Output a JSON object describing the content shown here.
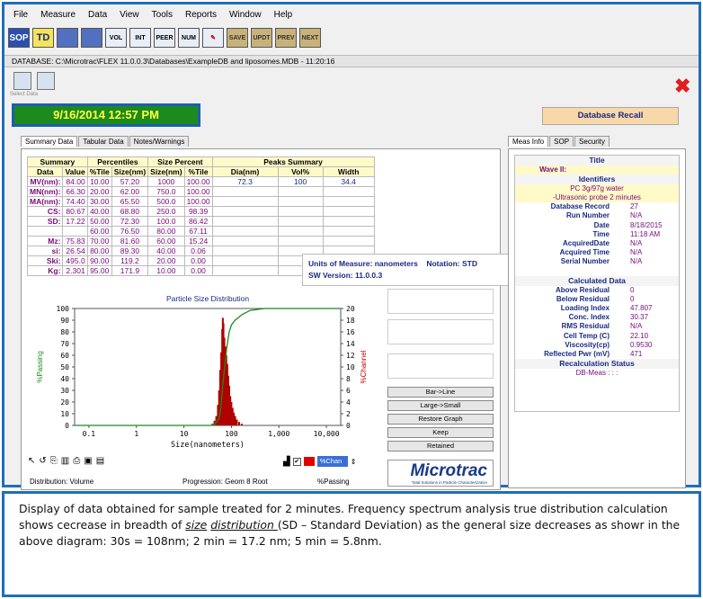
{
  "menu": [
    "File",
    "Measure",
    "Data",
    "View",
    "Tools",
    "Reports",
    "Window",
    "Help"
  ],
  "toolbar": [
    "SOP",
    "TD",
    "",
    "",
    "VOL",
    "INT",
    "PEER",
    "NUM",
    "",
    "SAVE",
    "UPDT",
    "PREV",
    "NEXT"
  ],
  "database_line": "DATABASE: C:\\Microtrac\\FLEX 11.0.0.3\\Databases\\ExampleDB and liposomes.MDB - 11:20:16",
  "small_label": "Select Data",
  "date": "9/16/2014  12:57 PM",
  "db_recall": "Database Recall",
  "tabs_left": [
    "Summary Data",
    "Tabular Data",
    "Notes/Warnings"
  ],
  "tabs_right": [
    "Meas Info",
    "SOP",
    "Security"
  ],
  "summary": {
    "group_headers": [
      "Summary",
      "Percentiles",
      "Size Percent",
      "Peaks Summary"
    ],
    "col_headers": [
      "Data",
      "Value",
      "%Tile",
      "Size(nm)",
      "Size(nm)",
      "%Tile",
      "Dia(nm)",
      "Vol%",
      "Width"
    ],
    "rows": [
      [
        "MV(nm):",
        "84.00",
        "10.00",
        "57.20",
        "1000",
        "100.00",
        "72.3",
        "100",
        "34.4"
      ],
      [
        "MN(nm):",
        "66.30",
        "20.00",
        "62.00",
        "750.0",
        "100.00",
        "",
        "",
        ""
      ],
      [
        "MA(nm):",
        "74.40",
        "30.00",
        "65.50",
        "500.0",
        "100.00",
        "",
        "",
        ""
      ],
      [
        "CS:",
        "80.67",
        "40.00",
        "68.80",
        "250.0",
        "98.39",
        "",
        "",
        ""
      ],
      [
        "SD:",
        "17.22",
        "50.00",
        "72.30",
        "100.0",
        "86.42",
        "",
        "",
        ""
      ],
      [
        "",
        "",
        "60.00",
        "76.50",
        "80.00",
        "67.11",
        "",
        "",
        ""
      ],
      [
        "Mz:",
        "75.83",
        "70.00",
        "81.60",
        "60.00",
        "15.24",
        "",
        "",
        ""
      ],
      [
        "si:",
        "26.54",
        "80.00",
        "89.30",
        "40.00",
        "0.06",
        "",
        "",
        ""
      ],
      [
        "Ski:",
        "495.0",
        "90.00",
        "119.2",
        "20.00",
        "0.00",
        "",
        "",
        ""
      ],
      [
        "Kg:",
        "2.301",
        "95.00",
        "171.9",
        "10.00",
        "0.00",
        "",
        "",
        ""
      ]
    ]
  },
  "units_box": {
    "units_label": "Units of Measure:",
    "units_value": "nanometers",
    "notation_label": "Notation:",
    "notation_value": "STD",
    "sw_label": "SW Version:",
    "sw_value": "11.0.0.3"
  },
  "chart_data": {
    "type": "bar",
    "title": "Particle Size Distribution",
    "xlabel": "Size(nanometers)",
    "ylabel_left": "%Passing",
    "ylabel_right": "%Channel",
    "x_ticks": [
      "0.1",
      "1",
      "10",
      "100",
      "1,000",
      "10,000"
    ],
    "y_left_ticks": [
      "0",
      "10",
      "20",
      "30",
      "40",
      "50",
      "60",
      "70",
      "80",
      "90",
      "100"
    ],
    "y_right_ticks": [
      "0",
      "2",
      "4",
      "6",
      "8",
      "10",
      "12",
      "14",
      "16",
      "18",
      "20"
    ],
    "x_scale": "log",
    "xlim": [
      0.05,
      20000
    ],
    "ylim_left": [
      0,
      100
    ],
    "ylim_right": [
      0,
      20
    ],
    "channels": [
      {
        "x": 40,
        "y": 0.3
      },
      {
        "x": 44,
        "y": 0.8
      },
      {
        "x": 48,
        "y": 1.6
      },
      {
        "x": 52,
        "y": 3.5
      },
      {
        "x": 55,
        "y": 6.0
      },
      {
        "x": 58,
        "y": 9.5
      },
      {
        "x": 61,
        "y": 12.5
      },
      {
        "x": 64,
        "y": 16.5
      },
      {
        "x": 66,
        "y": 18.4
      },
      {
        "x": 68,
        "y": 17.5
      },
      {
        "x": 71,
        "y": 15.0
      },
      {
        "x": 74,
        "y": 13.5
      },
      {
        "x": 78,
        "y": 12.0
      },
      {
        "x": 82,
        "y": 10.5
      },
      {
        "x": 86,
        "y": 8.5
      },
      {
        "x": 90,
        "y": 6.8
      },
      {
        "x": 95,
        "y": 5.0
      },
      {
        "x": 100,
        "y": 4.0
      },
      {
        "x": 106,
        "y": 3.0
      },
      {
        "x": 112,
        "y": 2.2
      },
      {
        "x": 120,
        "y": 1.6
      },
      {
        "x": 130,
        "y": 1.0
      },
      {
        "x": 145,
        "y": 0.6
      },
      {
        "x": 165,
        "y": 0.3
      }
    ],
    "cumulative": [
      {
        "x": 0.05,
        "y": 0
      },
      {
        "x": 38,
        "y": 0
      },
      {
        "x": 45,
        "y": 1
      },
      {
        "x": 55,
        "y": 6
      },
      {
        "x": 60,
        "y": 15
      },
      {
        "x": 66,
        "y": 35
      },
      {
        "x": 72,
        "y": 50
      },
      {
        "x": 80,
        "y": 67
      },
      {
        "x": 90,
        "y": 80
      },
      {
        "x": 100,
        "y": 86
      },
      {
        "x": 120,
        "y": 90
      },
      {
        "x": 170,
        "y": 95
      },
      {
        "x": 250,
        "y": 98.4
      },
      {
        "x": 500,
        "y": 100
      },
      {
        "x": 20000,
        "y": 100
      }
    ],
    "colors": {
      "bars": "#b00000",
      "cumulative": "#1a8a1a"
    }
  },
  "buttons_right": [
    "Bar->Line",
    "Large->Small",
    "Restore Graph",
    "Keep",
    "Retained"
  ],
  "legend_select": "%Chan",
  "footer": {
    "distribution": "Distribution: Volume",
    "progression": "Progression: Geom 8 Root",
    "passing": "%Passing"
  },
  "logo": "Microtrac",
  "logo_sub": "Total Solutions in Particle Characterization",
  "meas_info": {
    "title_head": "Title",
    "title_value": "Wave II:",
    "identifiers_head": "Identifiers",
    "id_line1": "PC 3g/97g water",
    "id_line2": "-Ultrasonic probe 2 minutes",
    "rows1": [
      [
        "Database Record",
        "27"
      ],
      [
        "Run Number",
        "N/A"
      ],
      [
        "Date",
        "8/18/2015"
      ],
      [
        "Time",
        "11:18 AM"
      ],
      [
        "AcquiredDate",
        "N/A"
      ],
      [
        "Acquired Time",
        "N/A"
      ],
      [
        "Serial Number",
        "N/A"
      ]
    ],
    "calc_head": "Calculated Data",
    "rows2": [
      [
        "Above Residual",
        "0"
      ],
      [
        "Below Residual",
        "0"
      ],
      [
        "Loading Index",
        "47.807"
      ],
      [
        "Conc. Index",
        "30.37"
      ],
      [
        "RMS Residual",
        "N/A"
      ],
      [
        "Cell Temp (C)",
        "22.10"
      ],
      [
        "Viscosity(cp)",
        "0.9530"
      ],
      [
        "Reflected Pwr (mV)",
        "471"
      ]
    ],
    "recalc_head": "Recalculation Status",
    "recalc_value": "DB-Meas : : :"
  },
  "caption": {
    "p1": "Display of data obtained for sample treated for 2 minutes. Frequency spectrum analysis true distribution calculation shows cecrease in breadth of ",
    "u1": "size",
    "sp": " ",
    "u2": "distribution ",
    "p2": "(SD – Standard Deviation) as the general size decreases as showr in the above diagram: 30s = 108nm; 2 min = 17.2 nm; 5 min = 5.8nm."
  }
}
